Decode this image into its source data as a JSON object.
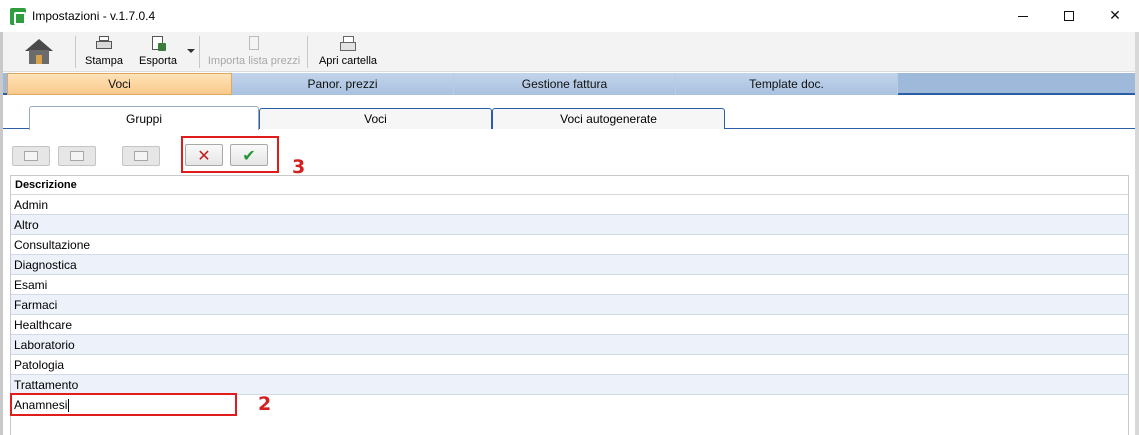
{
  "window": {
    "title": "Impostazioni  -  v.1.7.0.4",
    "minimize_glyph": "",
    "close_glyph": "✕"
  },
  "toolbar": {
    "items": [
      {
        "label": "Stampa",
        "icon": "printer-icon",
        "enabled": true
      },
      {
        "label": "Esporta",
        "icon": "export-icon",
        "enabled": true
      },
      {
        "label": "Importa lista prezzi",
        "icon": "import-price-list-icon",
        "enabled": false
      },
      {
        "label": "Apri cartella",
        "icon": "open-folder-icon",
        "enabled": true
      }
    ]
  },
  "main_tabs": [
    "Voci",
    "Panor. prezzi",
    "Gestione fattura",
    "Template doc."
  ],
  "main_tab_active": "Voci",
  "sub_tabs": [
    "Gruppi",
    "Voci",
    "Voci autogenerate"
  ],
  "sub_tab_active": "Gruppi",
  "actions": {
    "cancel_glyph": "✕",
    "confirm_glyph": "✔"
  },
  "callouts": {
    "step_3": "3",
    "step_2": "2"
  },
  "grid": {
    "header": "Descrizione",
    "rows": [
      "Admin",
      "Altro",
      "Consultazione",
      "Diagnostica",
      "Esami",
      "Farmaci",
      "Healthcare",
      "Laboratorio",
      "Patologia",
      "Trattamento"
    ],
    "editing_value": "Anamnesi"
  },
  "colors": {
    "active_tab": "#f8c98b",
    "tab_bar": "#9fb9da",
    "callout_red": "#e01c1c",
    "cancel_red": "#c21d1d",
    "confirm_green": "#24963a"
  }
}
